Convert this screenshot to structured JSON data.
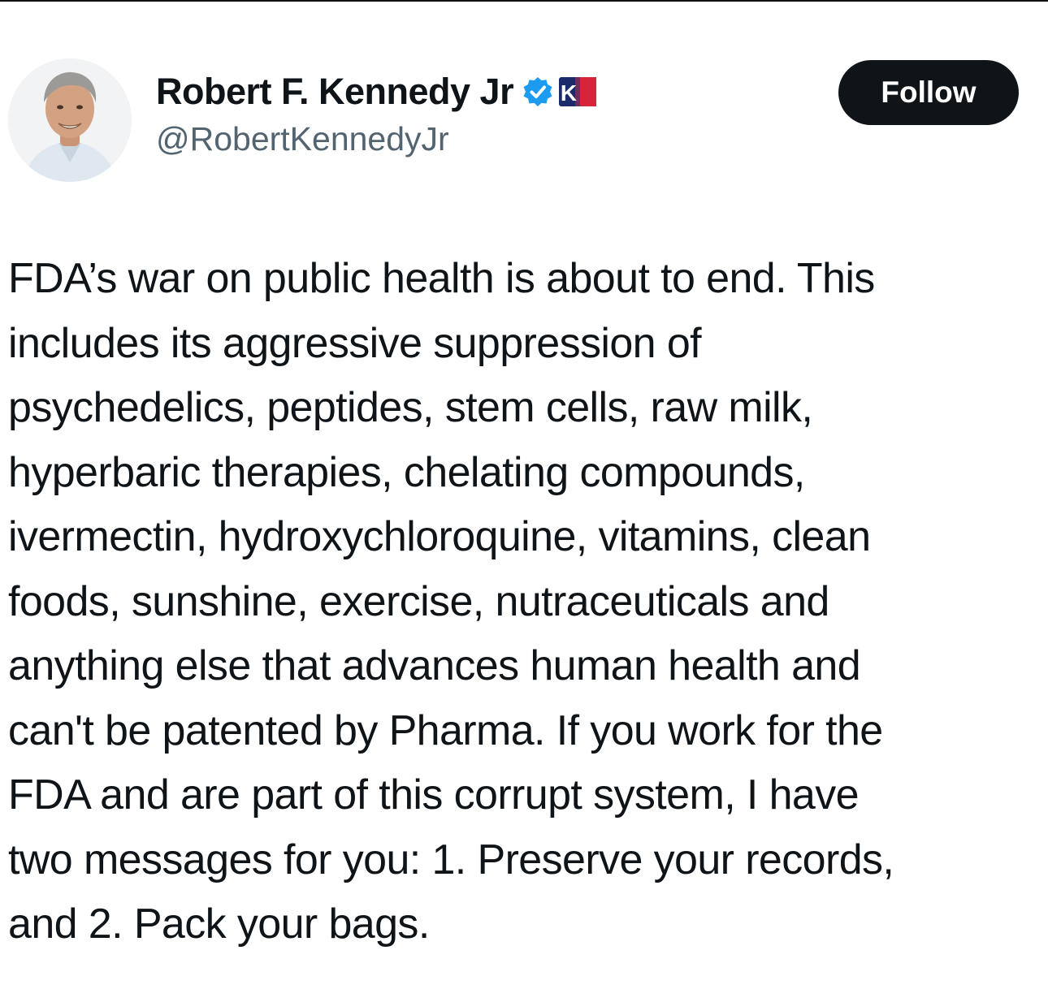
{
  "author": {
    "display_name": "Robert F. Kennedy Jr",
    "handle": "@RobertKennedyJr",
    "verified_icon": "verified-check-icon",
    "affiliate_badge_text": "K",
    "colors": {
      "verified": "#1d9bf0",
      "affiliate_left": "#1b2a6b",
      "affiliate_right": "#d6243a"
    }
  },
  "actions": {
    "follow_label": "Follow"
  },
  "tweet": {
    "lines": [
      "FDA’s war on public health is about to end. This",
      "includes its aggressive suppression of",
      "psychedelics, peptides, stem cells, raw milk,",
      "hyperbaric therapies, chelating compounds,",
      "ivermectin, hydroxychloroquine, vitamins, clean",
      "foods, sunshine, exercise, nutraceuticals and",
      "anything else that advances human health and",
      "can't be patented by Pharma. If you work for the",
      "FDA and are part of this corrupt system, I have",
      "two messages for you: 1. Preserve your records,",
      "and 2. Pack your bags."
    ]
  }
}
